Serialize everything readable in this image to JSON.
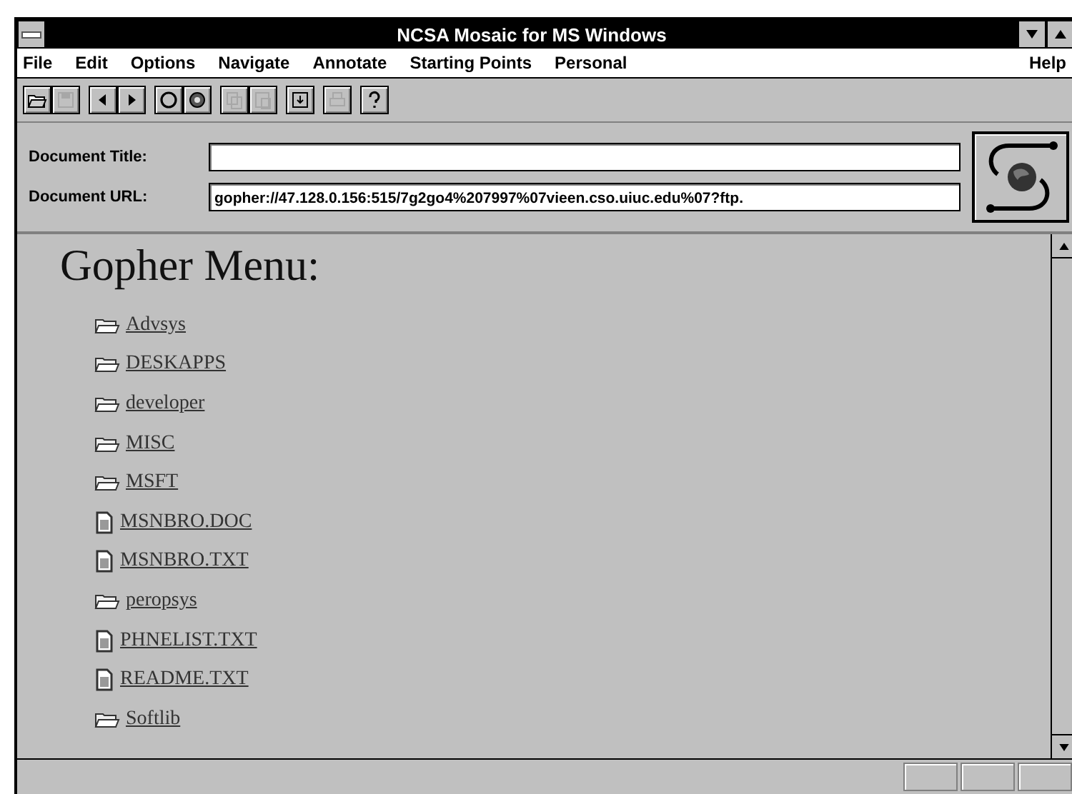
{
  "window": {
    "title": "NCSA Mosaic for MS Windows"
  },
  "menu": [
    {
      "label": "File"
    },
    {
      "label": "Edit"
    },
    {
      "label": "Options"
    },
    {
      "label": "Navigate"
    },
    {
      "label": "Annotate"
    },
    {
      "label": "Starting Points"
    },
    {
      "label": "Personal"
    },
    {
      "label": "Help",
      "kind": "right"
    }
  ],
  "toolbar": [
    {
      "kind": "open",
      "disabled": false
    },
    {
      "kind": "save",
      "disabled": true
    },
    {
      "kind": "back",
      "disabled": false
    },
    {
      "kind": "forward",
      "disabled": false
    },
    {
      "kind": "reload",
      "disabled": false
    },
    {
      "kind": "home",
      "disabled": false
    },
    {
      "kind": "copy",
      "disabled": true
    },
    {
      "kind": "paste",
      "disabled": true
    },
    {
      "kind": "download",
      "disabled": false
    },
    {
      "kind": "print",
      "disabled": true
    },
    {
      "kind": "help",
      "disabled": false
    }
  ],
  "document_title": {
    "label": "Document Title:"
  },
  "document_url": {
    "label": "Document URL:",
    "value": "gopher://47.128.0.156:515/7g2go4%207997%07vieen.cso.uiuc.edu%07?ftp."
  },
  "heading": "Gopher Menu:",
  "items": [
    {
      "kind": "folder",
      "label": "Advsys"
    },
    {
      "kind": "folder",
      "label": "DESKAPPS"
    },
    {
      "kind": "folder",
      "label": "developer"
    },
    {
      "kind": "folder",
      "label": "MISC"
    },
    {
      "kind": "folder",
      "label": "MSFT"
    },
    {
      "kind": "file",
      "label": "MSNBRO.DOC"
    },
    {
      "kind": "file",
      "label": "MSNBRO.TXT"
    },
    {
      "kind": "folder",
      "label": "peropsys"
    },
    {
      "kind": "file",
      "label": "PHNELIST.TXT"
    },
    {
      "kind": "file",
      "label": "README.TXT"
    },
    {
      "kind": "folder",
      "label": "Softlib"
    }
  ]
}
